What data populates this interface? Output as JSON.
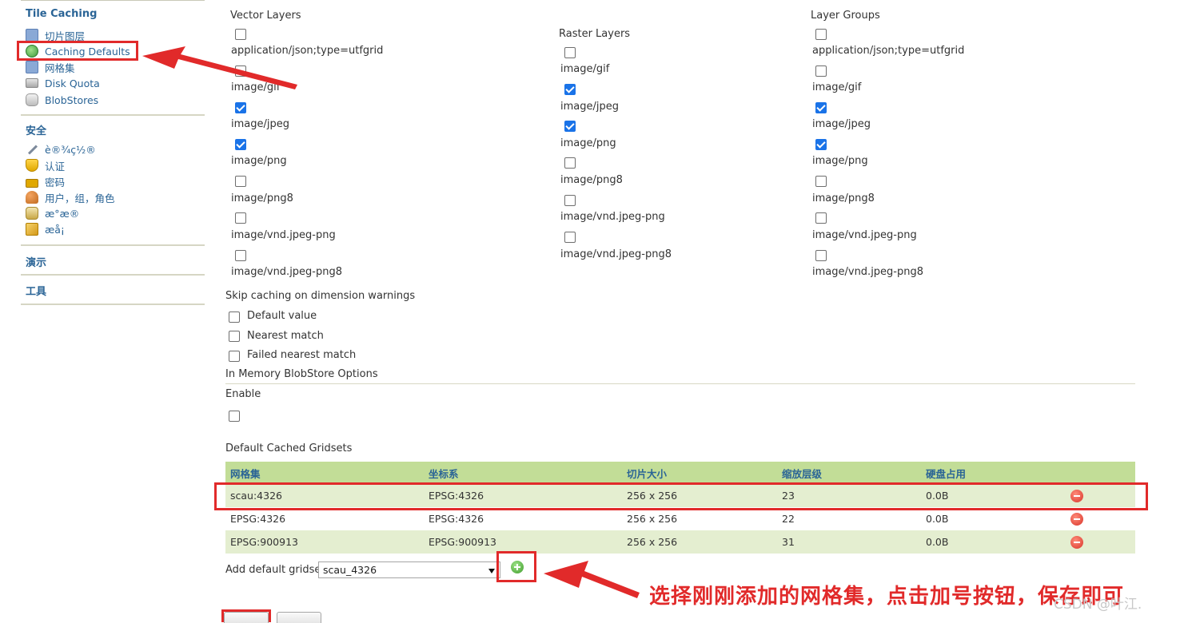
{
  "sidebar": {
    "tile_caching": {
      "heading": "Tile Caching",
      "items": [
        {
          "label": "切片图层",
          "icon": "grid-icon"
        },
        {
          "label": "Caching Defaults",
          "icon": "globe-icon"
        },
        {
          "label": "网格集",
          "icon": "grid-icon"
        },
        {
          "label": "Disk Quota",
          "icon": "disk-icon"
        },
        {
          "label": "BlobStores",
          "icon": "database-icon"
        }
      ]
    },
    "security": {
      "heading": "安全",
      "items": [
        {
          "label": "è®¾ç½®",
          "icon": "wrench-icon"
        },
        {
          "label": "认证",
          "icon": "shield-icon"
        },
        {
          "label": "密码",
          "icon": "lock-icon"
        },
        {
          "label": "用户，组，角色",
          "icon": "users-icon"
        },
        {
          "label": "æ°æ®",
          "icon": "database-edit-icon"
        },
        {
          "label": "æå¡",
          "icon": "edit-icon"
        }
      ]
    },
    "demos": {
      "heading": "演示"
    },
    "tools": {
      "heading": "工具"
    }
  },
  "formats": {
    "vector": {
      "title": "Vector Layers",
      "items": [
        {
          "label": "application/json;type=utfgrid",
          "checked": false
        },
        {
          "label": "image/gif",
          "checked": false
        },
        {
          "label": "image/jpeg",
          "checked": true
        },
        {
          "label": "image/png",
          "checked": true
        },
        {
          "label": "image/png8",
          "checked": false
        },
        {
          "label": "image/vnd.jpeg-png",
          "checked": false
        },
        {
          "label": "image/vnd.jpeg-png8",
          "checked": false
        }
      ]
    },
    "raster": {
      "title": "Raster Layers",
      "items": [
        {
          "label": "image/gif",
          "checked": false
        },
        {
          "label": "image/jpeg",
          "checked": true
        },
        {
          "label": "image/png",
          "checked": true
        },
        {
          "label": "image/png8",
          "checked": false
        },
        {
          "label": "image/vnd.jpeg-png",
          "checked": false
        },
        {
          "label": "image/vnd.jpeg-png8",
          "checked": false
        }
      ]
    },
    "groups": {
      "title": "Layer Groups",
      "items": [
        {
          "label": "application/json;type=utfgrid",
          "checked": false
        },
        {
          "label": "image/gif",
          "checked": false
        },
        {
          "label": "image/jpeg",
          "checked": true
        },
        {
          "label": "image/png",
          "checked": true
        },
        {
          "label": "image/png8",
          "checked": false
        },
        {
          "label": "image/vnd.jpeg-png",
          "checked": false
        },
        {
          "label": "image/vnd.jpeg-png8",
          "checked": false
        }
      ]
    }
  },
  "skip_caching": {
    "title": "Skip caching on dimension warnings",
    "options": [
      {
        "label": "Default value",
        "checked": false
      },
      {
        "label": "Nearest match",
        "checked": false
      },
      {
        "label": "Failed nearest match",
        "checked": false
      }
    ]
  },
  "in_memory": {
    "title": "In Memory BlobStore Options",
    "enable_label": "Enable",
    "enabled": false
  },
  "gridsets": {
    "title": "Default Cached Gridsets",
    "headers": [
      "网格集",
      "坐标系",
      "切片大小",
      "缩放层级",
      "硬盘占用"
    ],
    "rows": [
      [
        "scau:4326",
        "EPSG:4326",
        "256 x 256",
        "23",
        "0.0B"
      ],
      [
        "EPSG:4326",
        "EPSG:4326",
        "256 x 256",
        "22",
        "0.0B"
      ],
      [
        "EPSG:900913",
        "EPSG:900913",
        "256 x 256",
        "31",
        "0.0B"
      ]
    ],
    "add_label": "Add default gridset",
    "selected": "scau_4326"
  },
  "annotation": {
    "text": "选择刚刚添加的网格集，点击加号按钮，保存即可",
    "color": "#e12a2a",
    "watermark": "CSDN @叶江."
  }
}
